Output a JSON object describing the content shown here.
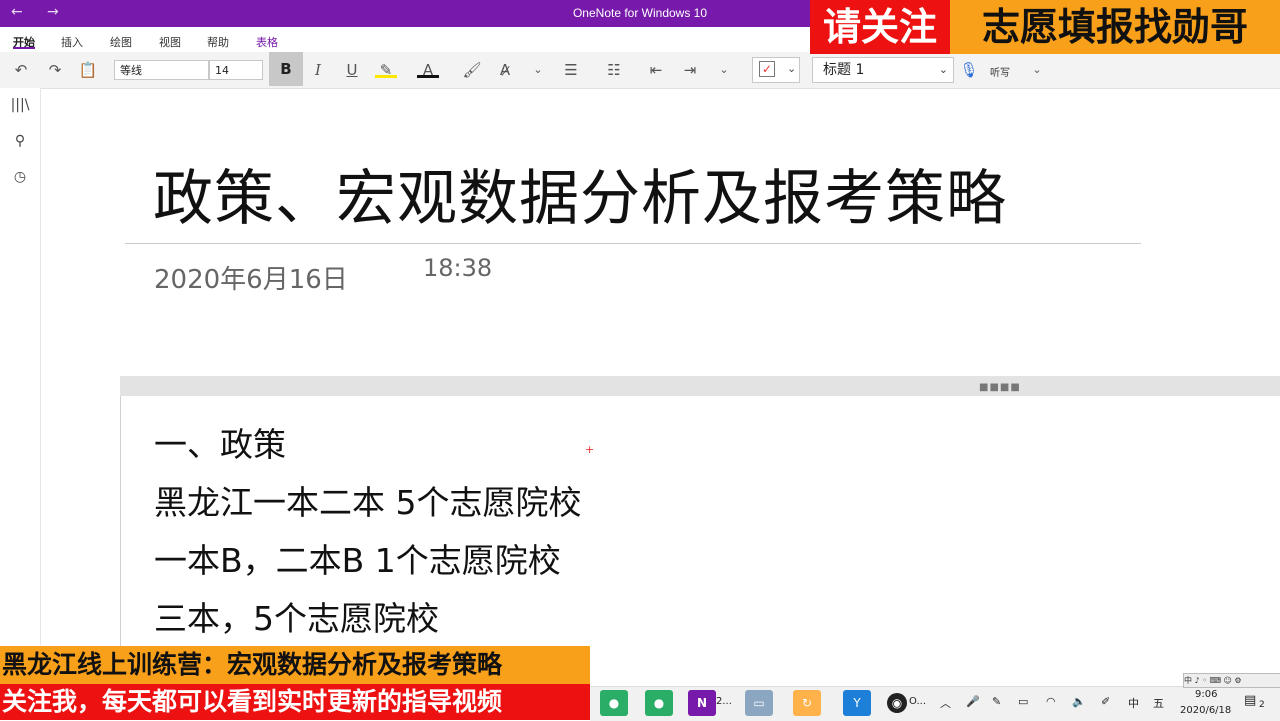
{
  "window": {
    "title": "OneNote for Windows 10",
    "back": "←",
    "forward": "→"
  },
  "tabs": [
    "开始",
    "插入",
    "绘图",
    "视图",
    "帮助",
    "表格"
  ],
  "toolbar": {
    "font_name": "等线",
    "font_size": "14",
    "bold": "B",
    "italic": "I",
    "underline": "U",
    "font_color": "A",
    "style": "标题 1",
    "dictate": "听写"
  },
  "page": {
    "title": "政策、宏观数据分析及报考策略",
    "date": "2020年6月16日",
    "time": "18:38",
    "lines": [
      "一、政策",
      "黑龙江一本二本 5个志愿院校",
      "一本B，二本B 1个志愿院校",
      "三本，5个志愿院校"
    ],
    "grip": "■■■■",
    "plus": "+"
  },
  "overlays": {
    "top_red": "请关注",
    "top_yellow": "志愿填报找勋哥",
    "bottom_yellow": "黑龙江线上训练营：宏观数据分析及报考策略",
    "bottom_red": "关注我，每天都可以看到实时更新的指导视频"
  },
  "taskbar": {
    "onenote_label": "2...",
    "obs_label": "O...",
    "ime_bar": "中 ♪ ◦ ⌨ ☺ ⚙",
    "ime_lang": "中",
    "ime_mode": "五",
    "time": "9:06",
    "date": "2020/6/18",
    "notification_count": "2"
  },
  "colors": {
    "accent": "#7719aa",
    "overlay_red": "#e11111",
    "overlay_yellow": "#f9a01b"
  }
}
